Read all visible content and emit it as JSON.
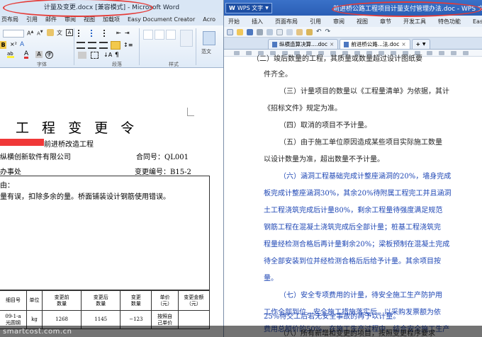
{
  "word": {
    "title": "计量及变更.docx [兼容模式] - Microsoft Word",
    "tabs": [
      "页布局",
      "引用",
      "邮件",
      "审阅",
      "视图",
      "加载项",
      "Easy Document Creator",
      "Acro"
    ],
    "group_font": "字体",
    "group_para": "段落",
    "group_style": "样式",
    "fanti": "范文",
    "doc": {
      "title": "工 程 变 更 令",
      "project": "前进桥改造工程",
      "company": "纵横创新软件有限公司",
      "contract_label": "合同号：",
      "contract_no": "QL001",
      "office": "办事处",
      "change_label": "变更编号：",
      "change_no": "B15-2",
      "reason_label": "由：",
      "reason": "量有误，扣除多余的量。桥面铺装设计钢筋使用错误。",
      "table": {
        "headers": [
          "细目号",
          "单位",
          "变更前\n数量",
          "变更后\n数量",
          "变更\n数量",
          "单价\n（元）",
          "变更金额\n（元）"
        ],
        "row": [
          "09-1-a\n光圆钢",
          "kg",
          "1268",
          "1145",
          "−123",
          "按照自\n己单价",
          ""
        ]
      }
    }
  },
  "wps": {
    "title_app": "WPS 文字",
    "title": "前进桥公路工程项目计量支付管理办法.doc - WPS 文字",
    "tabs": [
      "开始",
      "插入",
      "页面布局",
      "引用",
      "审阅",
      "视图",
      "章节",
      "开发工具",
      "特色功能",
      "Easy Document Creator"
    ],
    "doc_tabs": [
      "纵横造算决算....doc",
      "前进桥公路...法.doc"
    ],
    "add_tab": "+",
    "paragraphs": [
      {
        "text": "（二）竣后数量的工程，其质量或数量超过设计图纸要",
        "blue": false
      },
      {
        "text": "件齐全。",
        "blue": false
      },
      {
        "text": "（三）计量项目的数量以《工程量清单》为依据，其计",
        "blue": false
      },
      {
        "text": "《招标文件》规定为准。",
        "blue": false
      },
      {
        "text": "（四）取消的项目不予计量。",
        "blue": false
      },
      {
        "text": "（五）由于施工单位原因造成某些项目实际施工数量",
        "blue": false
      },
      {
        "text": "以设计数量为准，超出数量不予计量。",
        "blue": false
      },
      {
        "text": "（六）涵洞工程基础完成计整座涵洞的20%，墙身完成",
        "blue": true
      },
      {
        "text": "板完成计整座涵洞30%，其余20%待附属工程完工并且涵洞",
        "blue": true
      },
      {
        "text": "土工程浇筑完成后计量80%，剩余工程量待强度满足规范",
        "blue": true
      },
      {
        "text": "钢筋工程在混凝土浇筑完成后全部计量；桩基工程浇筑完",
        "blue": true
      },
      {
        "text": "程量经检测合格后再计量剩余20%；梁板预制在混凝土完成",
        "blue": true
      },
      {
        "text": "待全部安装到位并经检测合格后后给予计量。其余项目按",
        "blue": true
      },
      {
        "text": "量。",
        "blue": true
      },
      {
        "text": "（七）安全专项费用的计量，待安全施工生产防护用",
        "blue": true
      },
      {
        "text": "工作全部到位，安全施工措施落实后，以采购发票额为依",
        "blue": true
      },
      {
        "text": "费用总额价的50%，在施工生产过程中，结合安全施工生产",
        "blue": true
      },
      {
        "text": "25%待交工后若无安全事故的再予以计量。",
        "blue": true
      },
      {
        "text": "（八）所有新增和变更的项目，按照变更程序要求",
        "blue": false
      }
    ]
  },
  "watermark": "smartcost.com.cn"
}
